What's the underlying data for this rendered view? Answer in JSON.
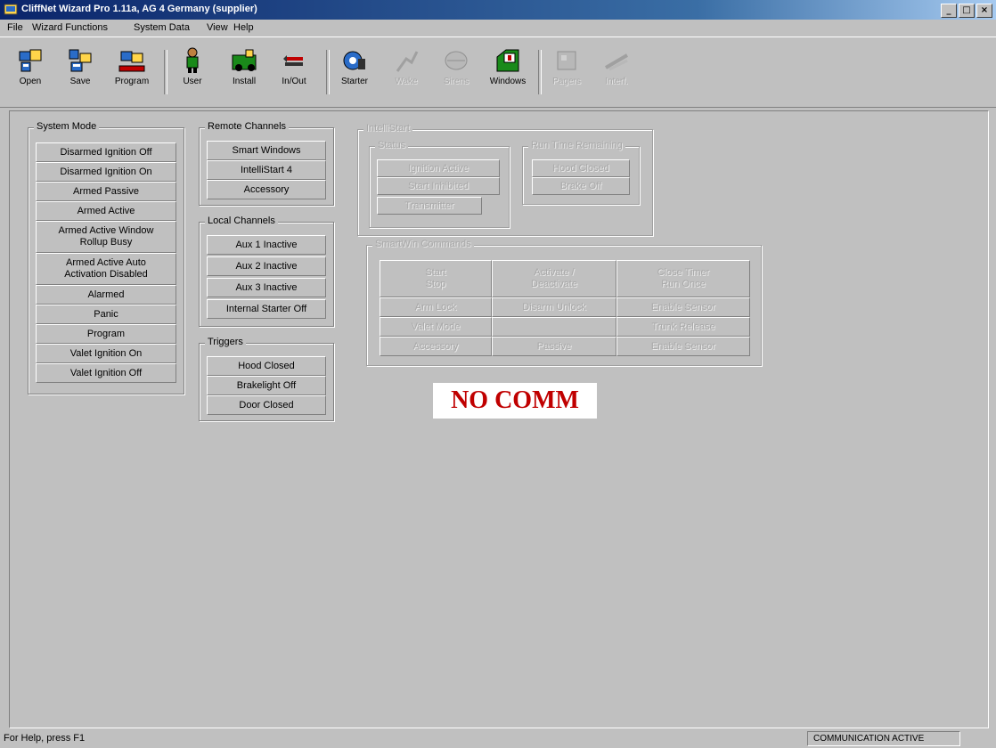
{
  "window": {
    "title": "CliffNet Wizard Pro 1.11a, AG 4 Germany (supplier)",
    "buttons": {
      "minimize": "_",
      "maximize": "□",
      "close": "×"
    }
  },
  "menu": [
    "File",
    "Wizard Functions",
    "System Data",
    "View",
    "Help"
  ],
  "toolbar": [
    {
      "label": "Open",
      "icon": "open-icon",
      "enabled": true
    },
    {
      "label": "Save",
      "icon": "save-icon",
      "enabled": true
    },
    {
      "label": "Program",
      "icon": "program-icon",
      "enabled": true
    },
    {
      "label": "User",
      "icon": "user-icon",
      "enabled": true
    },
    {
      "label": "Install",
      "icon": "install-icon",
      "enabled": true
    },
    {
      "label": "In/Out",
      "icon": "in-out-icon",
      "enabled": true
    },
    {
      "label": "Starter",
      "icon": "starter-icon",
      "enabled": true
    },
    {
      "label": "Wake",
      "icon": "wake-icon",
      "enabled": false
    },
    {
      "label": "Sirens",
      "icon": "sirens-icon",
      "enabled": false
    },
    {
      "label": "Windows",
      "icon": "windows-icon",
      "enabled": true
    },
    {
      "label": "Pagers",
      "icon": "pagers-icon",
      "enabled": false
    },
    {
      "label": "Interf.",
      "icon": "interface-icon",
      "enabled": false
    }
  ],
  "system_mode": {
    "title": "System Mode",
    "items": [
      "Disarmed Ignition Off",
      "Disarmed Ignition On",
      "Armed Passive",
      "Armed Active",
      "Armed Active Window\nRollup Busy",
      "Armed Active Auto\nActivation Disabled",
      "Alarmed",
      "Panic",
      "Program",
      "Valet Ignition On",
      "Valet Ignition Off"
    ]
  },
  "remote_channels": {
    "title": "Remote Channels",
    "items": [
      "Smart Windows",
      "IntelliStart 4",
      "Accessory"
    ]
  },
  "local_channels": {
    "title": "Local Channels",
    "items": [
      "Aux 1 Inactive",
      "Aux 2 Inactive",
      "Aux 3 Inactive",
      "Internal Starter Off"
    ]
  },
  "triggers": {
    "title": "Triggers",
    "items": [
      "Hood Closed",
      "Brakelight Off",
      "Door Closed"
    ]
  },
  "intellistart": {
    "title": "IntelliStart",
    "status": {
      "title": "Status",
      "items": [
        "Ignition Active",
        "Start Inhibited",
        "Transmitter"
      ]
    },
    "run_time": {
      "title": "Run Time Remaining",
      "items": [
        "Hood Closed",
        "Brake Off"
      ]
    }
  },
  "smartwin": {
    "title": "SmartWin Commands",
    "grid": [
      [
        "Start\nStop",
        "Activate /\nDeactivate",
        "Close Timer\nRun Once"
      ],
      [
        "Arm Lock",
        "Disarm Unlock",
        "Enable Sensor"
      ],
      [
        "Valet Mode",
        "",
        "Trunk Release"
      ],
      [
        "Accessory",
        "Passive",
        "Enable Sensor"
      ]
    ]
  },
  "no_comm": "NO COMM",
  "status_bar": {
    "help": "For Help, press F1",
    "comm": "COMMUNICATION ACTIVE"
  }
}
